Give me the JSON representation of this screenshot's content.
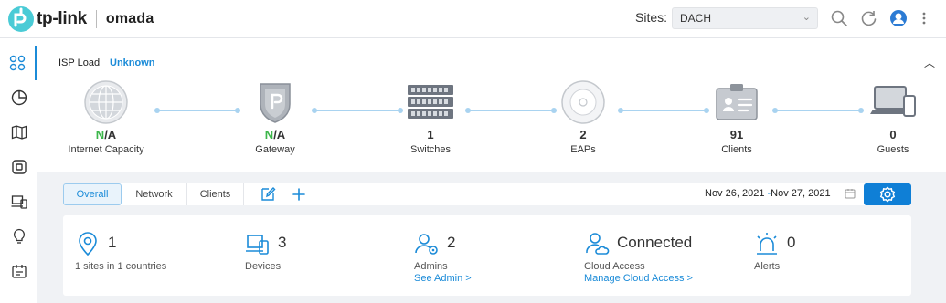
{
  "brand": {
    "logo_text": "tp-link",
    "product": "omada"
  },
  "header": {
    "sites_label": "Sites:",
    "site_selected": "DACH"
  },
  "colors": {
    "accent": "#1b8bd8",
    "ok": "#3cb64a",
    "button": "#0f7fd6"
  },
  "sidebar": {
    "items": [
      {
        "icon": "dashboard-grid-icon",
        "active": true
      },
      {
        "icon": "statistics-pie-icon"
      },
      {
        "icon": "map-icon"
      },
      {
        "icon": "devices-icon"
      },
      {
        "icon": "clients-icon"
      },
      {
        "icon": "insights-bulb-icon"
      },
      {
        "icon": "logs-icon"
      }
    ]
  },
  "topology": {
    "isp_label": "ISP Load",
    "isp_value": "Unknown",
    "nodes": [
      {
        "value_prefix": "N",
        "value_rest": "/A",
        "label": "Internet Capacity",
        "icon": "globe-icon"
      },
      {
        "value_prefix": "N",
        "value_rest": "/A",
        "label": "Gateway",
        "icon": "gateway-shield-icon"
      },
      {
        "value_prefix": "",
        "value_rest": "1",
        "label": "Switches",
        "icon": "switch-icon"
      },
      {
        "value_prefix": "",
        "value_rest": "2",
        "label": "EAPs",
        "icon": "access-point-icon"
      },
      {
        "value_prefix": "",
        "value_rest": "91",
        "label": "Clients",
        "icon": "client-card-icon"
      },
      {
        "value_prefix": "",
        "value_rest": "0",
        "label": "Guests",
        "icon": "laptop-phone-icon"
      }
    ]
  },
  "tabs": [
    {
      "label": "Overall",
      "active": true
    },
    {
      "label": "Network"
    },
    {
      "label": "Clients"
    }
  ],
  "date_range": {
    "start": "Nov 26, 2021",
    "separator": "-",
    "end": "Nov 27, 2021"
  },
  "stats": [
    {
      "value": "1",
      "sub": "1 sites in 1 countries",
      "link": "",
      "icon": "location-pin-icon"
    },
    {
      "value": "3",
      "sub": "Devices",
      "link": "",
      "icon": "devices-icon"
    },
    {
      "value": "2",
      "sub": "Admins",
      "link": "See Admin >",
      "icon": "admins-icon"
    },
    {
      "value": "Connected",
      "sub": "Cloud Access",
      "link": "Manage Cloud Access >",
      "icon": "cloud-user-icon"
    },
    {
      "value": "0",
      "sub": "Alerts",
      "link": "",
      "icon": "alarm-light-icon"
    }
  ]
}
